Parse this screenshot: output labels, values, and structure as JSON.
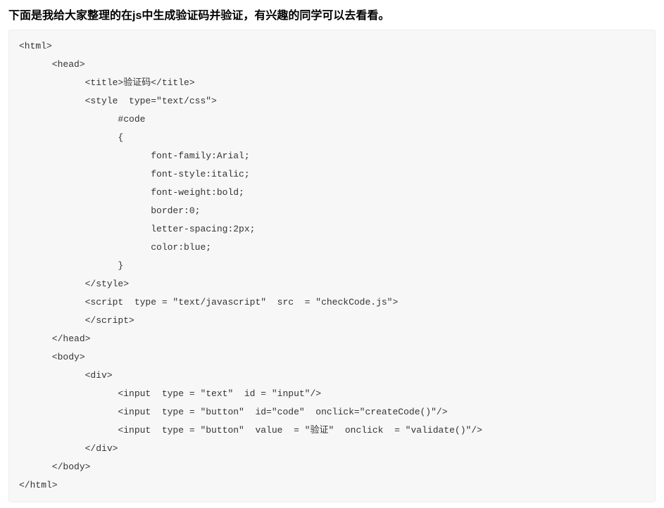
{
  "heading": "下面是我给大家整理的在js中生成验证码并验证，有兴趣的同学可以去看看。",
  "code": {
    "lines": [
      "<html>",
      "      <head>",
      "            <title>验证码</title>",
      "            <style  type=\"text/css\">",
      "                  #code",
      "                  {",
      "                        font-family:Arial;",
      "                        font-style:italic;",
      "                        font-weight:bold;",
      "                        border:0;",
      "                        letter-spacing:2px;",
      "                        color:blue;",
      "                  }",
      "            </style>",
      "            <script  type = \"text/javascript\"  src  = \"checkCode.js\">",
      "            </script>",
      "      </head>",
      "      <body>",
      "            <div>",
      "                  <input  type = \"text\"  id = \"input\"/>",
      "                  <input  type = \"button\"  id=\"code\"  onclick=\"createCode()\"/>",
      "                  <input  type = \"button\"  value  = \"验证\"  onclick  = \"validate()\"/>",
      "            </div>",
      "      </body>",
      "</html>"
    ]
  }
}
